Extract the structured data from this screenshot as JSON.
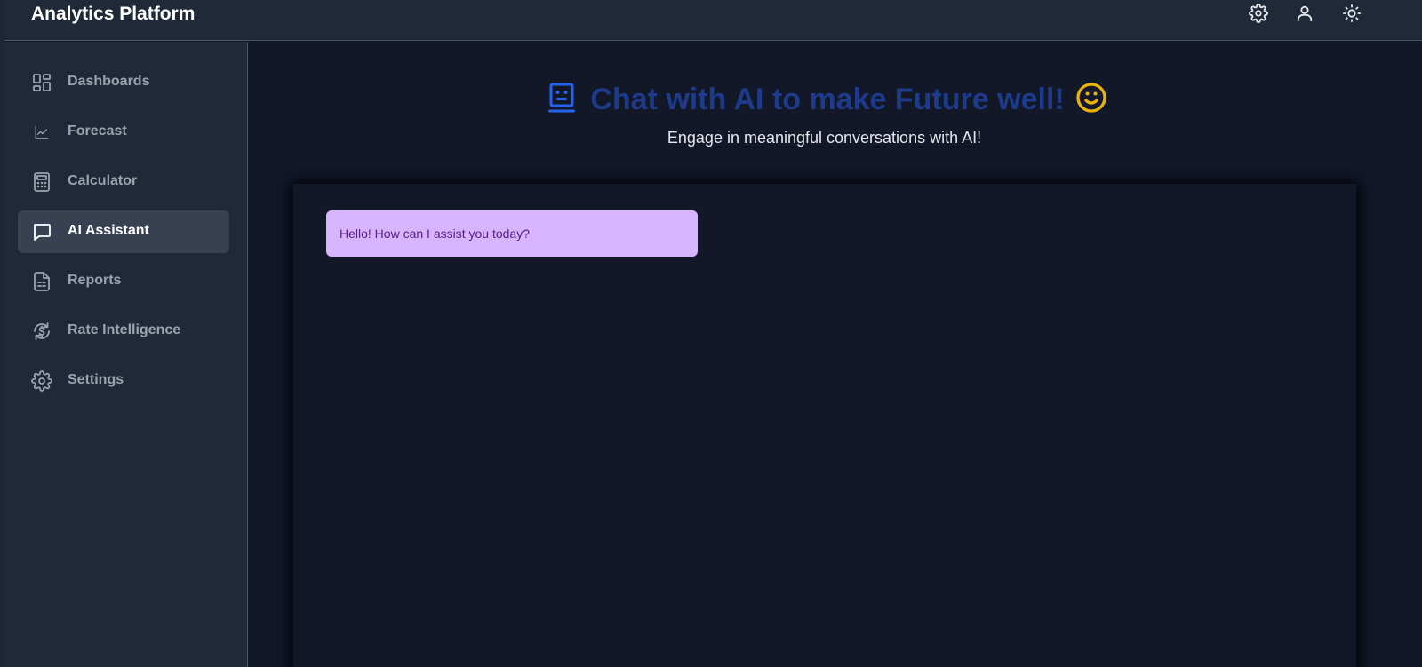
{
  "app": {
    "title": "Analytics Platform"
  },
  "header": {
    "icons": [
      "gear-icon",
      "user-icon",
      "sun-icon"
    ]
  },
  "sidebar": {
    "items": [
      {
        "label": "Dashboards",
        "icon": "grid-icon",
        "active": false
      },
      {
        "label": "Forecast",
        "icon": "line-chart-icon",
        "active": false
      },
      {
        "label": "Calculator",
        "icon": "calculator-icon",
        "active": false
      },
      {
        "label": "AI Assistant",
        "icon": "chat-bubble-icon",
        "active": true
      },
      {
        "label": "Reports",
        "icon": "document-icon",
        "active": false
      },
      {
        "label": "Rate Intelligence",
        "icon": "dollar-refresh-icon",
        "active": false
      },
      {
        "label": "Settings",
        "icon": "gear-icon",
        "active": false
      }
    ]
  },
  "main": {
    "title": "Chat with AI to make Future well!",
    "subtitle": "Engage in meaningful conversations with AI!",
    "messages": [
      {
        "sender": "ai",
        "text": "Hello! How can I assist you today?"
      }
    ]
  },
  "colors": {
    "background": "#121828",
    "sidebar": "#1f2937",
    "active_item": "#374151",
    "title": "#1e3a8a",
    "robot_icon": "#2563eb",
    "smile_icon": "#eab308",
    "bubble": "#d8b4fe",
    "bubble_text": "#581c87"
  }
}
